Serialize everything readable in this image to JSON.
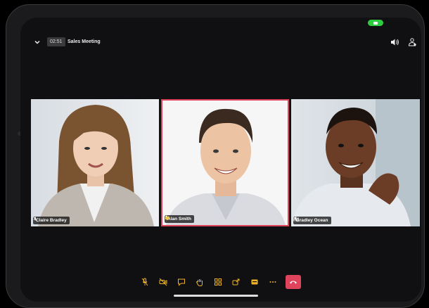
{
  "meeting": {
    "timer": "02:51",
    "title": "Sales Meeting"
  },
  "participants": [
    {
      "name": "Claire Bradley",
      "muted": true,
      "host": false,
      "active": false
    },
    {
      "name": "Alan Smith",
      "muted": true,
      "host": false,
      "active": true
    },
    {
      "name": "Bradley Ocean",
      "muted": true,
      "host": true,
      "active": false
    }
  ],
  "toolbar": [
    "mute-icon",
    "video-off-icon",
    "chat-icon",
    "raise-hand-icon",
    "grid-icon",
    "share-icon",
    "more-panel-icon",
    "ellipsis-icon"
  ],
  "colors": {
    "accent_red": "#e0435c",
    "camera_green": "#2ecc40",
    "background": "#101012"
  }
}
